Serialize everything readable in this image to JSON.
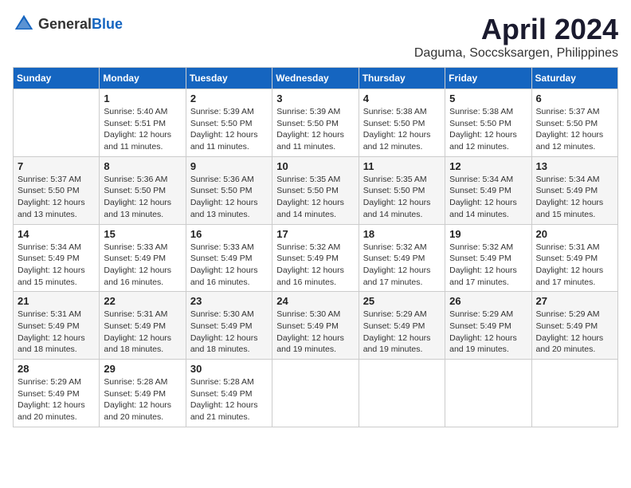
{
  "logo": {
    "text_general": "General",
    "text_blue": "Blue"
  },
  "title": "April 2024",
  "location": "Daguma, Soccsksargen, Philippines",
  "days_of_week": [
    "Sunday",
    "Monday",
    "Tuesday",
    "Wednesday",
    "Thursday",
    "Friday",
    "Saturday"
  ],
  "weeks": [
    [
      null,
      {
        "day": "1",
        "sunrise": "5:40 AM",
        "sunset": "5:51 PM",
        "daylight": "12 hours and 11 minutes."
      },
      {
        "day": "2",
        "sunrise": "5:39 AM",
        "sunset": "5:50 PM",
        "daylight": "12 hours and 11 minutes."
      },
      {
        "day": "3",
        "sunrise": "5:39 AM",
        "sunset": "5:50 PM",
        "daylight": "12 hours and 11 minutes."
      },
      {
        "day": "4",
        "sunrise": "5:38 AM",
        "sunset": "5:50 PM",
        "daylight": "12 hours and 12 minutes."
      },
      {
        "day": "5",
        "sunrise": "5:38 AM",
        "sunset": "5:50 PM",
        "daylight": "12 hours and 12 minutes."
      },
      {
        "day": "6",
        "sunrise": "5:37 AM",
        "sunset": "5:50 PM",
        "daylight": "12 hours and 12 minutes."
      }
    ],
    [
      {
        "day": "7",
        "sunrise": "5:37 AM",
        "sunset": "5:50 PM",
        "daylight": "12 hours and 13 minutes."
      },
      {
        "day": "8",
        "sunrise": "5:36 AM",
        "sunset": "5:50 PM",
        "daylight": "12 hours and 13 minutes."
      },
      {
        "day": "9",
        "sunrise": "5:36 AM",
        "sunset": "5:50 PM",
        "daylight": "12 hours and 13 minutes."
      },
      {
        "day": "10",
        "sunrise": "5:35 AM",
        "sunset": "5:50 PM",
        "daylight": "12 hours and 14 minutes."
      },
      {
        "day": "11",
        "sunrise": "5:35 AM",
        "sunset": "5:50 PM",
        "daylight": "12 hours and 14 minutes."
      },
      {
        "day": "12",
        "sunrise": "5:34 AM",
        "sunset": "5:49 PM",
        "daylight": "12 hours and 14 minutes."
      },
      {
        "day": "13",
        "sunrise": "5:34 AM",
        "sunset": "5:49 PM",
        "daylight": "12 hours and 15 minutes."
      }
    ],
    [
      {
        "day": "14",
        "sunrise": "5:34 AM",
        "sunset": "5:49 PM",
        "daylight": "12 hours and 15 minutes."
      },
      {
        "day": "15",
        "sunrise": "5:33 AM",
        "sunset": "5:49 PM",
        "daylight": "12 hours and 16 minutes."
      },
      {
        "day": "16",
        "sunrise": "5:33 AM",
        "sunset": "5:49 PM",
        "daylight": "12 hours and 16 minutes."
      },
      {
        "day": "17",
        "sunrise": "5:32 AM",
        "sunset": "5:49 PM",
        "daylight": "12 hours and 16 minutes."
      },
      {
        "day": "18",
        "sunrise": "5:32 AM",
        "sunset": "5:49 PM",
        "daylight": "12 hours and 17 minutes."
      },
      {
        "day": "19",
        "sunrise": "5:32 AM",
        "sunset": "5:49 PM",
        "daylight": "12 hours and 17 minutes."
      },
      {
        "day": "20",
        "sunrise": "5:31 AM",
        "sunset": "5:49 PM",
        "daylight": "12 hours and 17 minutes."
      }
    ],
    [
      {
        "day": "21",
        "sunrise": "5:31 AM",
        "sunset": "5:49 PM",
        "daylight": "12 hours and 18 minutes."
      },
      {
        "day": "22",
        "sunrise": "5:31 AM",
        "sunset": "5:49 PM",
        "daylight": "12 hours and 18 minutes."
      },
      {
        "day": "23",
        "sunrise": "5:30 AM",
        "sunset": "5:49 PM",
        "daylight": "12 hours and 18 minutes."
      },
      {
        "day": "24",
        "sunrise": "5:30 AM",
        "sunset": "5:49 PM",
        "daylight": "12 hours and 19 minutes."
      },
      {
        "day": "25",
        "sunrise": "5:29 AM",
        "sunset": "5:49 PM",
        "daylight": "12 hours and 19 minutes."
      },
      {
        "day": "26",
        "sunrise": "5:29 AM",
        "sunset": "5:49 PM",
        "daylight": "12 hours and 19 minutes."
      },
      {
        "day": "27",
        "sunrise": "5:29 AM",
        "sunset": "5:49 PM",
        "daylight": "12 hours and 20 minutes."
      }
    ],
    [
      {
        "day": "28",
        "sunrise": "5:29 AM",
        "sunset": "5:49 PM",
        "daylight": "12 hours and 20 minutes."
      },
      {
        "day": "29",
        "sunrise": "5:28 AM",
        "sunset": "5:49 PM",
        "daylight": "12 hours and 20 minutes."
      },
      {
        "day": "30",
        "sunrise": "5:28 AM",
        "sunset": "5:49 PM",
        "daylight": "12 hours and 21 minutes."
      },
      null,
      null,
      null,
      null
    ]
  ]
}
